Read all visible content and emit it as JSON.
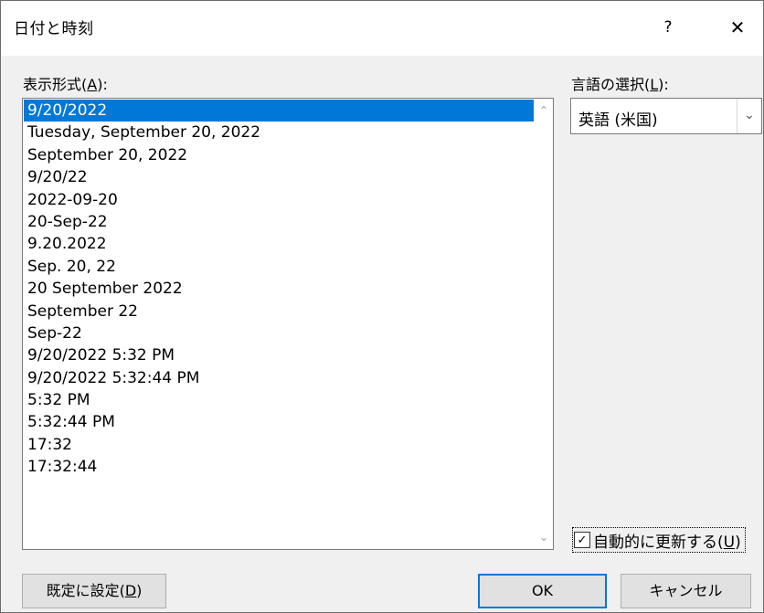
{
  "window": {
    "title": "日付と時刻",
    "help": "?",
    "close": "✕"
  },
  "formats": {
    "label_pre": "表示形式(",
    "label_key": "A",
    "label_post": "):",
    "items": [
      "9/20/2022",
      "Tuesday, September 20, 2022",
      "September 20, 2022",
      "9/20/22",
      "2022-09-20",
      "20-Sep-22",
      "9.20.2022",
      "Sep. 20, 22",
      "20 September 2022",
      "September 22",
      "Sep-22",
      "9/20/2022 5:32 PM",
      "9/20/2022 5:32:44 PM",
      "5:32 PM",
      "5:32:44 PM",
      "17:32",
      "17:32:44"
    ],
    "selected_index": 0
  },
  "language": {
    "label_pre": "言語の選択(",
    "label_key": "L",
    "label_post": "):",
    "value": "英語 (米国)"
  },
  "auto_update": {
    "label_pre": "自動的に更新する(",
    "label_key": "U",
    "label_post": ")",
    "checked": true
  },
  "buttons": {
    "default_pre": "既定に設定(",
    "default_key": "D",
    "default_post": ")",
    "ok": "OK",
    "cancel": "キャンセル"
  }
}
